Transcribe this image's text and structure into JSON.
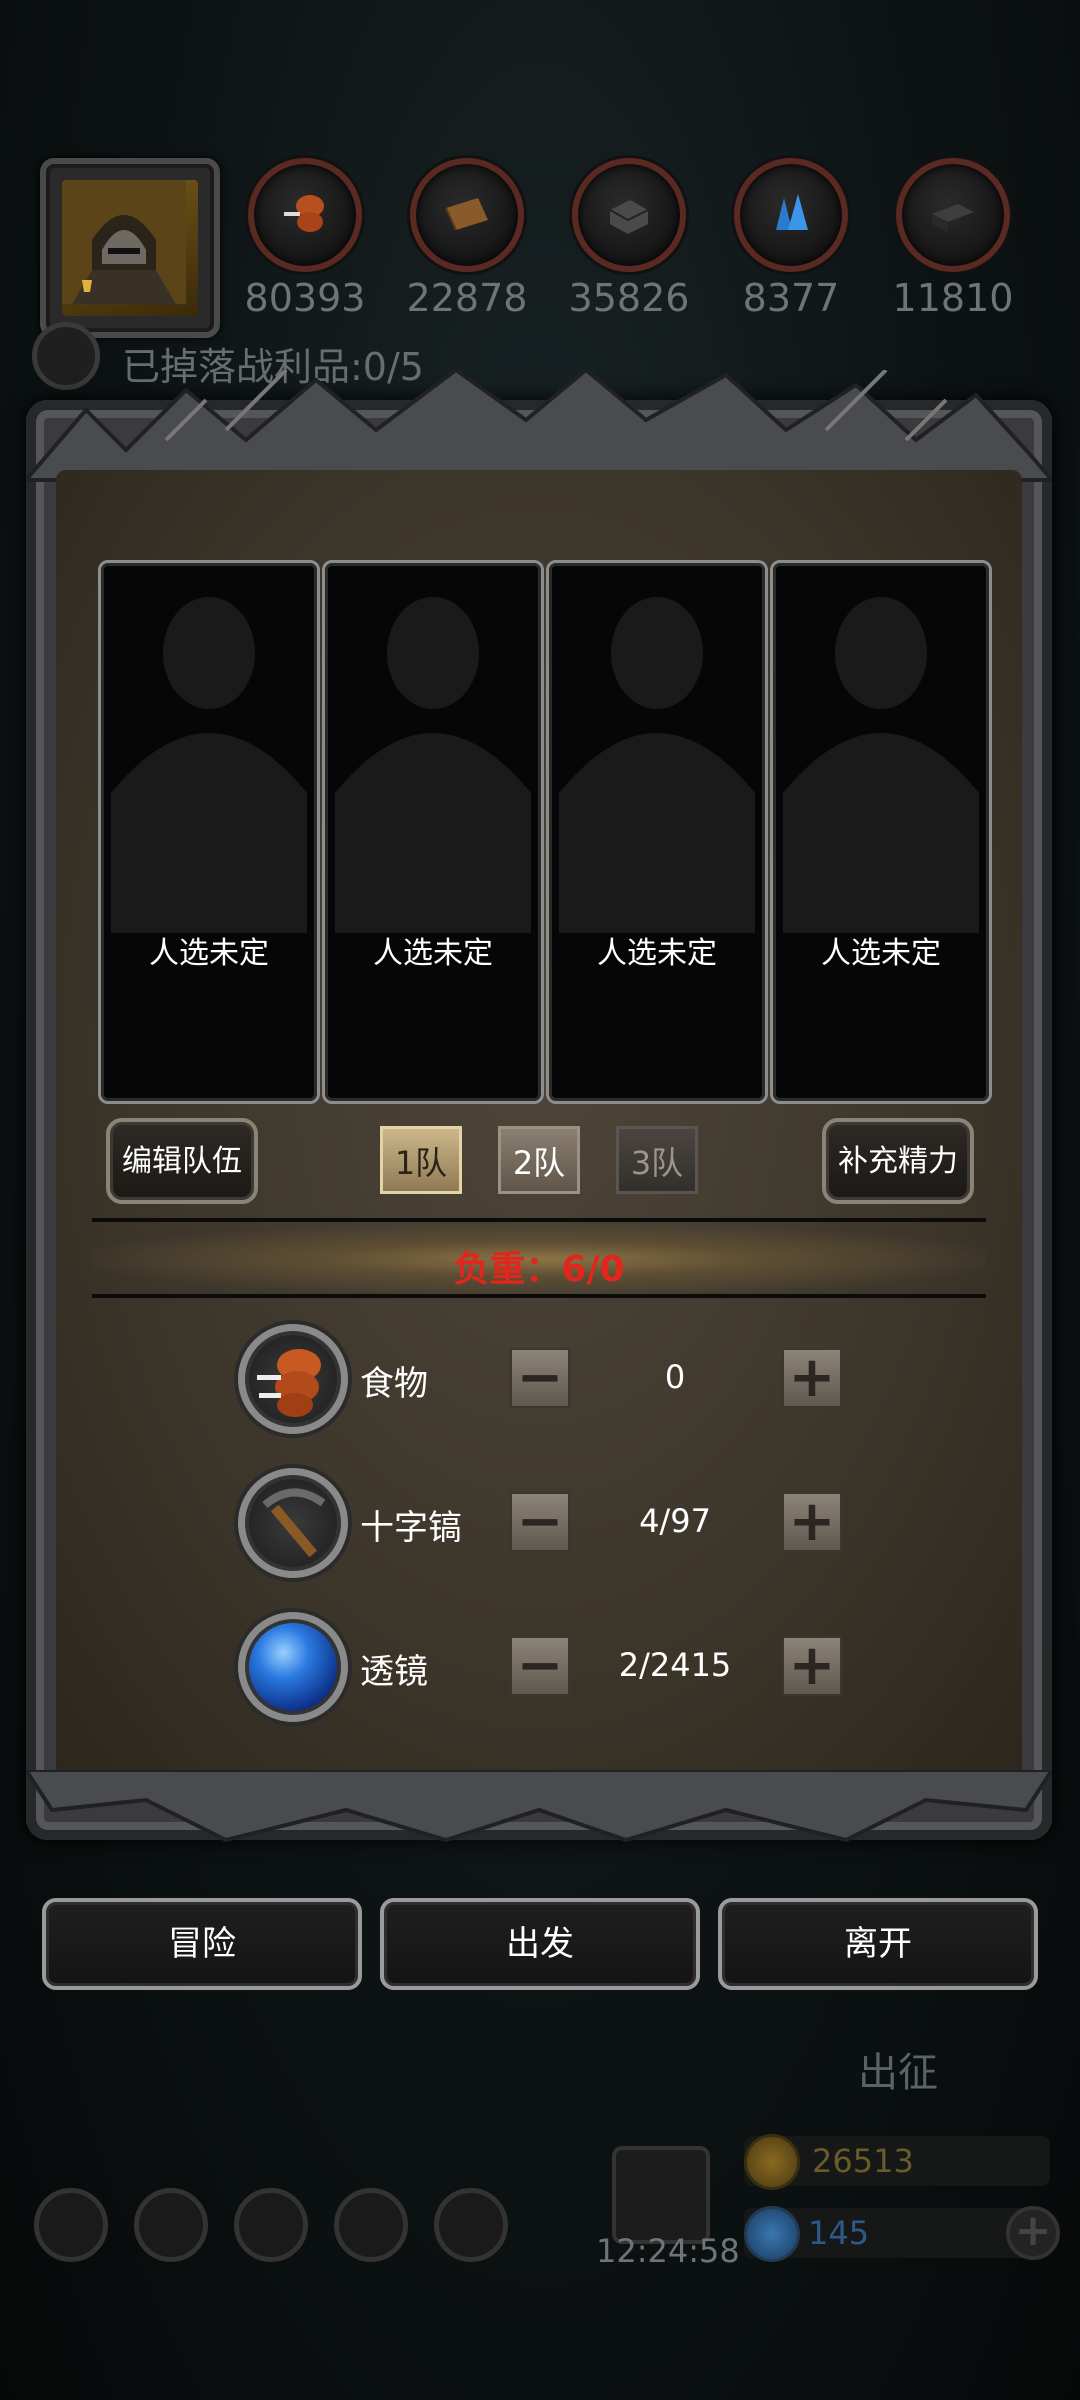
{
  "resources": [
    {
      "name": "food-icon",
      "count": "80393"
    },
    {
      "name": "wood-icon",
      "count": "22878"
    },
    {
      "name": "stone-icon",
      "count": "35826"
    },
    {
      "name": "crystal-icon",
      "count": "8377"
    },
    {
      "name": "iron-icon",
      "count": "11810"
    }
  ],
  "loot": {
    "text": "已掉落战利品:0/5"
  },
  "slots": [
    {
      "label": "人选未定"
    },
    {
      "label": "人选未定"
    },
    {
      "label": "人选未定"
    },
    {
      "label": "人选未定"
    }
  ],
  "team_controls": {
    "edit": "编辑队伍",
    "refill": "补充精力",
    "teams": [
      "1队",
      "2队",
      "3队"
    ],
    "selected_team": "1队"
  },
  "weight": {
    "text": "负重：6/0"
  },
  "supplies": [
    {
      "icon": "food-icon",
      "label": "食物",
      "value": "0"
    },
    {
      "icon": "pickaxe-icon",
      "label": "十字镐",
      "value": "4/97"
    },
    {
      "icon": "lens-icon",
      "label": "透镜",
      "value": "2/2415"
    }
  ],
  "actions": {
    "adventure": "冒险",
    "depart": "出发",
    "leave": "离开"
  },
  "background": {
    "expedition": "出征",
    "clock": "12:24:58",
    "gold": "26513",
    "gems": "145"
  },
  "colors": {
    "weight_red": "#e0261d",
    "gold_text": "#6b5a2a",
    "gem_text": "#2e5a8a"
  }
}
